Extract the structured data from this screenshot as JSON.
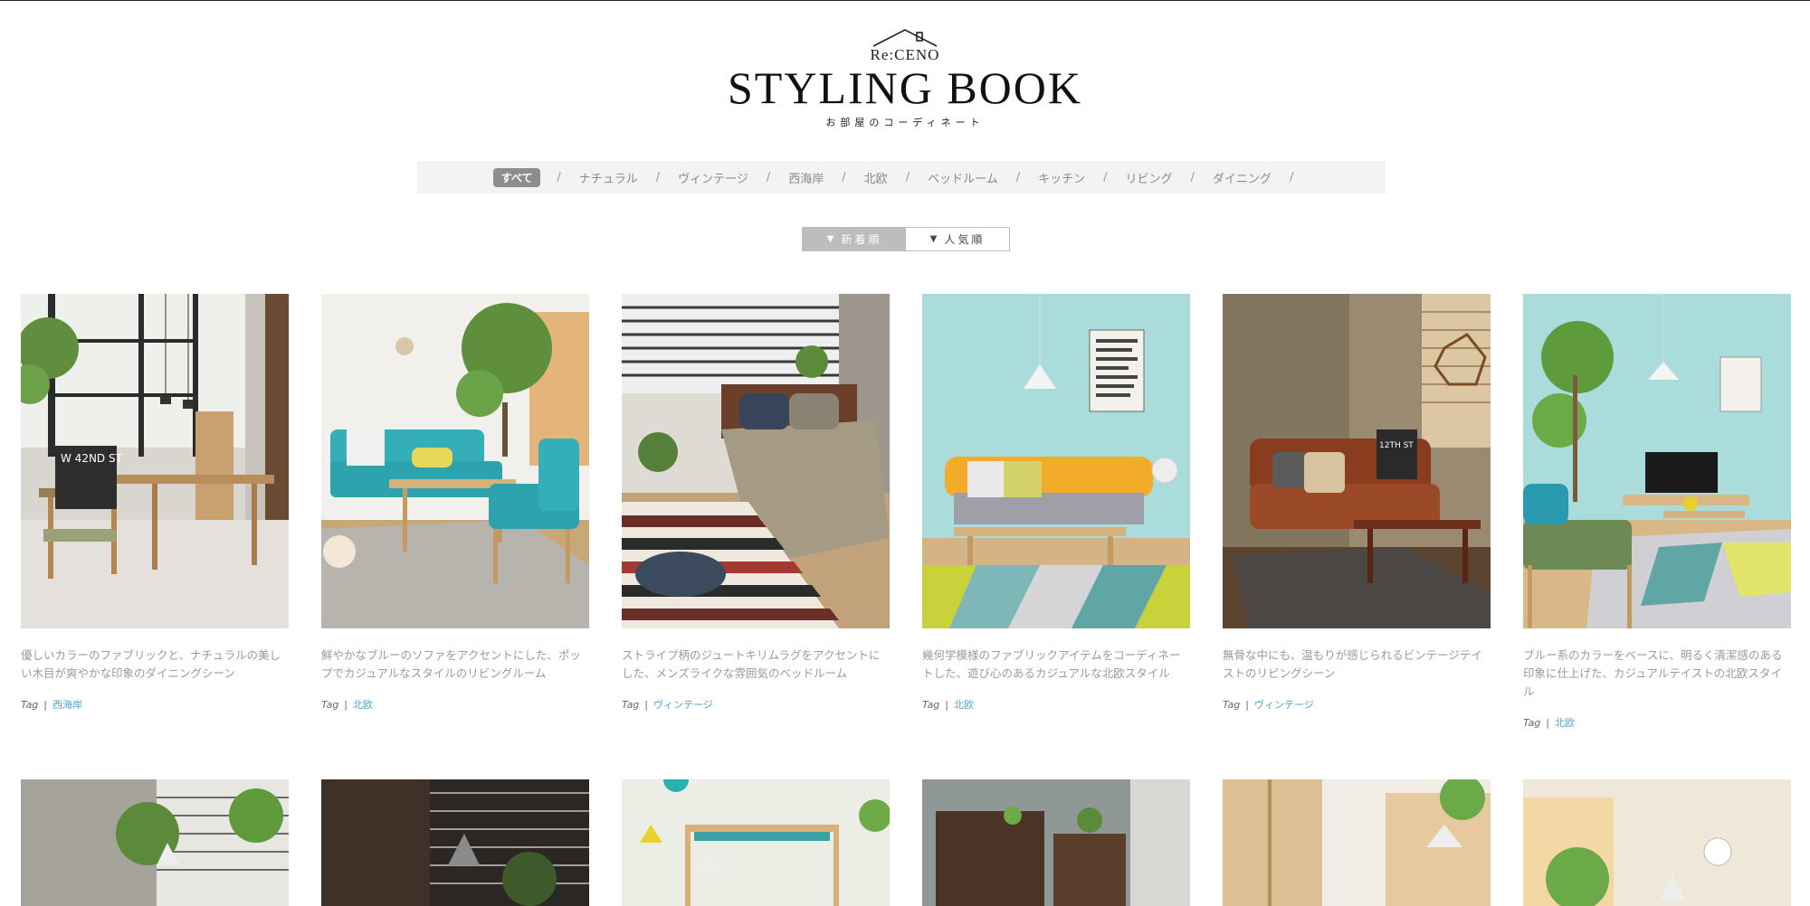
{
  "header": {
    "brand": "Re:CENO",
    "title": "STYLING BOOK",
    "subtitle": "お部屋のコーディネート"
  },
  "categories": [
    {
      "label": "すべて",
      "active": true
    },
    {
      "label": "ナチュラル"
    },
    {
      "label": "ヴィンテージ"
    },
    {
      "label": "西海岸"
    },
    {
      "label": "北欧"
    },
    {
      "label": "ベッドルーム"
    },
    {
      "label": "キッチン"
    },
    {
      "label": "リビング"
    },
    {
      "label": "ダイニング"
    }
  ],
  "sort": {
    "newest": "新着順",
    "popular": "人気順"
  },
  "tag_label": "Tag",
  "cards": [
    {
      "desc": "優しいカラーのファブリックと、ナチュラルの美しい木目が爽やかな印象のダイニングシーン",
      "tag": "西海岸"
    },
    {
      "desc": "鮮やかなブルーのソファをアクセントにした、ポップでカジュアルなスタイルのリビングルーム",
      "tag": "北欧"
    },
    {
      "desc": "ストライプ柄のジュートキリムラグをアクセントにした、メンズライクな雰囲気のベッドルーム",
      "tag": "ヴィンテージ"
    },
    {
      "desc": "幾何学模様のファブリックアイテムをコーディネートした、遊び心のあるカジュアルな北欧スタイル",
      "tag": "北欧"
    },
    {
      "desc": "無骨な中にも、温もりが感じられるビンテージテイストのリビングシーン",
      "tag": "ヴィンテージ"
    },
    {
      "desc": "ブルー系のカラーをベースに、明るく清潔感のある印象に仕上げた、カジュアルテイストの北欧スタイル",
      "tag": "北欧"
    }
  ],
  "poster_texts": {
    "card1": "W 42ND ST",
    "card5": "12TH ST"
  }
}
